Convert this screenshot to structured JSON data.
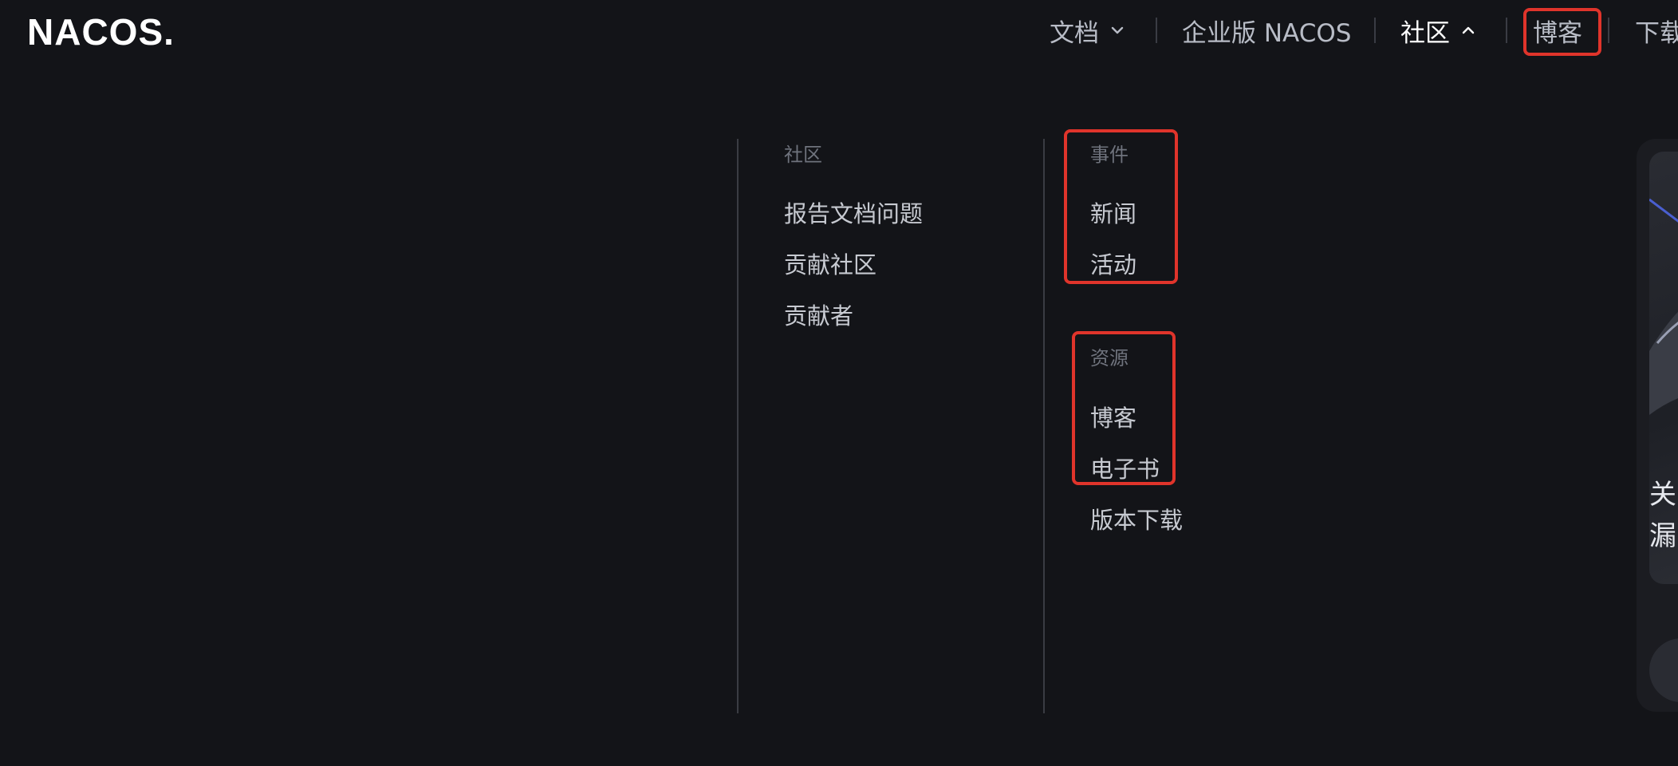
{
  "logo": {
    "text": "NACOS."
  },
  "nav": {
    "docs": "文档",
    "enterprise": "企业版 NACOS",
    "community": "社区",
    "blog": "博客",
    "download": "下载"
  },
  "menu": {
    "community": {
      "title": "社区",
      "items": [
        "报告文档问题",
        "贡献社区",
        "贡献者"
      ]
    },
    "events": {
      "title": "事件",
      "items": [
        "新闻",
        "活动"
      ]
    },
    "resources": {
      "title": "资源",
      "items": [
        "博客",
        "电子书",
        "版本下载"
      ]
    }
  },
  "preview_card": {
    "line1": "关",
    "line2": "漏"
  },
  "colors": {
    "background": "#131418",
    "highlight": "#e0342b",
    "nav_active": "#ffffff",
    "nav_text": "#b8bcc6"
  }
}
